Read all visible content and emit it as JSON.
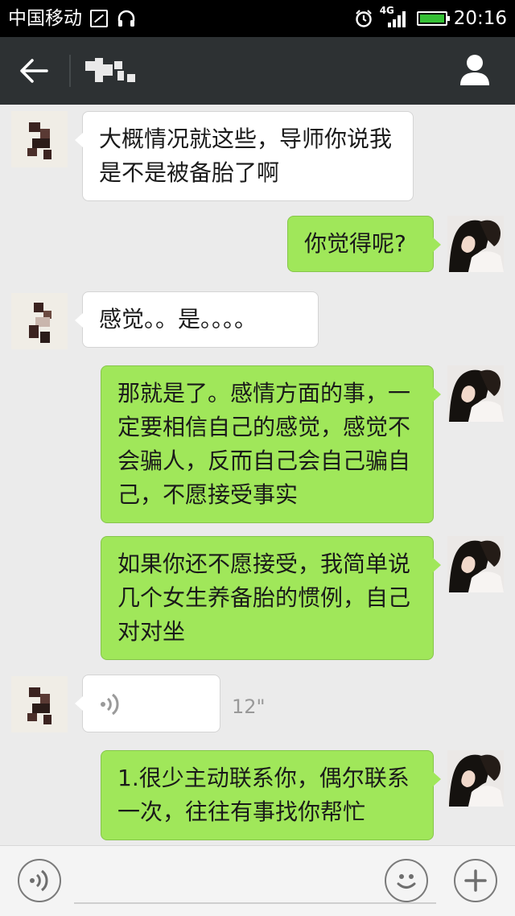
{
  "status_bar": {
    "carrier": "中国移动",
    "network": "4G",
    "time": "20:16"
  },
  "header": {
    "back_icon": "arrow-left-icon",
    "profile_icon": "person-icon"
  },
  "messages": [
    {
      "side": "in",
      "text": "大概情况就这些，导师你说我是不是被备胎了啊"
    },
    {
      "side": "out",
      "text": "你觉得呢?"
    },
    {
      "side": "in",
      "text": "感觉。。是。。。。"
    },
    {
      "side": "out",
      "text": "那就是了。感情方面的事，一定要相信自己的感觉，感觉不会骗人，反而自己会自己骗自己，不愿接受事实"
    },
    {
      "side": "out",
      "text": "如果你还不愿接受，我简单说几个女生养备胎的惯例，自己对对坐"
    },
    {
      "side": "in",
      "type": "voice",
      "duration": "12\""
    },
    {
      "side": "out",
      "text": "1.很少主动联系你，偶尔联系一次，往往有事找你帮忙"
    }
  ],
  "input_bar": {
    "voice_icon": "voice-icon",
    "emoji_icon": "emoji-icon",
    "plus_icon": "plus-icon"
  },
  "colors": {
    "header_bg": "#2d3133",
    "outgoing_bubble": "#a0e75a",
    "incoming_bubble": "#ffffff",
    "chat_bg": "#ebebeb"
  }
}
